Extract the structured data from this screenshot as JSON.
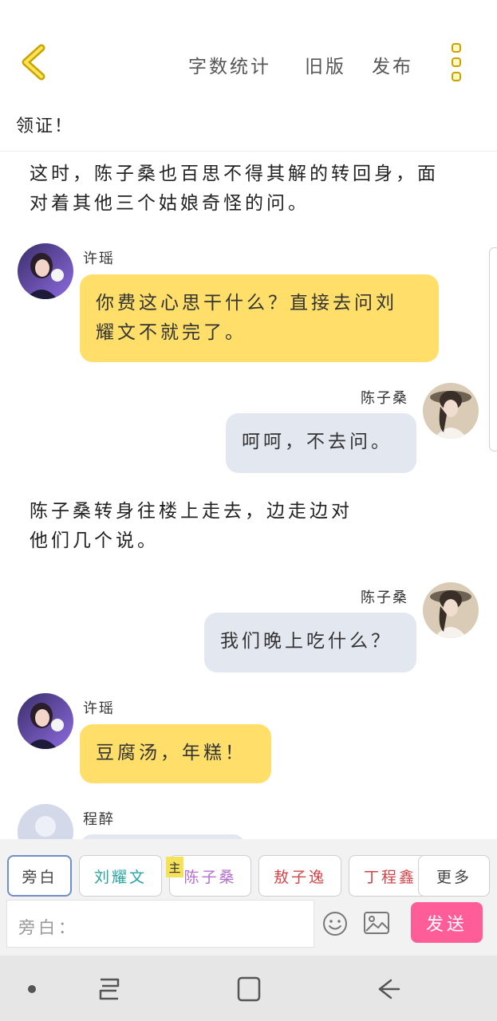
{
  "header": {
    "word_count": "字数统计",
    "old_version": "旧版",
    "publish": "发布",
    "chapter_title": "领证！"
  },
  "messages": {
    "m1": "这时，陈子桑也百思不得其解的转回身，面对着其他三个姑娘奇怪的问。",
    "m1_line1": "这时，陈子桑也百思不得其解的转回身，面",
    "m1_line2": "对着其他三个姑娘奇怪的问。",
    "m2_name": "许瑶",
    "m2_line1": "你费这心思干什么？直接去问刘",
    "m2_line2": "耀文不就完了。",
    "m3_name": "陈子桑",
    "m3_text": "呵呵，不去问。",
    "m4_line1": "陈子桑转身往楼上走去，边走边对",
    "m4_line2": "他们几个说。",
    "m5_name": "陈子桑",
    "m5_text": "我们晚上吃什么？",
    "m6_name": "许瑶",
    "m6_text": "豆腐汤，年糕！",
    "m7_name": "程醉"
  },
  "characters": {
    "narrator": "旁白",
    "c1": "刘耀文",
    "c2": "陈子桑",
    "c2_badge": "主",
    "c3": "敖子逸",
    "c4": "丁程鑫",
    "more": "更多"
  },
  "character_colors": {
    "narrator": "#444444",
    "c1": "#2aa3a3",
    "c2": "#b36fd0",
    "c3": "#d0454a",
    "c4": "#d0454a",
    "more": "#444444"
  },
  "input": {
    "placeholder": "旁白：",
    "send": "发送"
  },
  "icons": {
    "back": "chevron-left-icon",
    "menu": "more-vertical-icon",
    "emoji": "smiley-icon",
    "image": "image-icon"
  },
  "colors": {
    "accent_yellow": "#ffdf6a",
    "send_pink": "#ff5d97",
    "bubble_gray": "#e3e8f0"
  }
}
